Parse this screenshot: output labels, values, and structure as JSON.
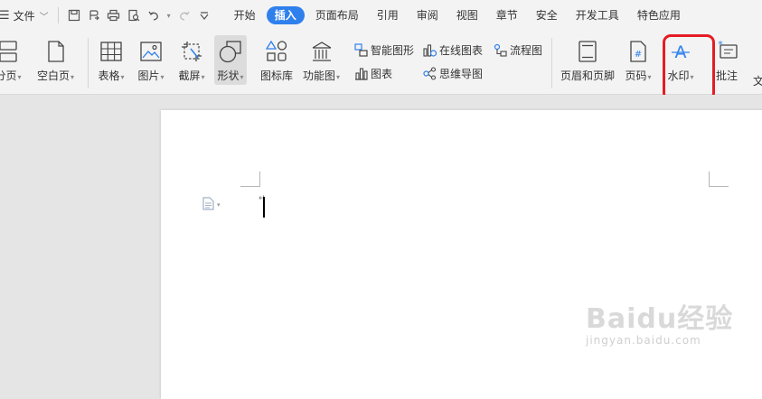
{
  "menu": {
    "file_label": "文件",
    "tabs": [
      "开始",
      "插入",
      "页面布局",
      "引用",
      "审阅",
      "视图",
      "章节",
      "安全",
      "开发工具",
      "特色应用"
    ],
    "active_tab": "插入",
    "accent_color": "#2f80ed"
  },
  "ribbon": {
    "page_break": "分页",
    "blank_page": "空白页",
    "table": "表格",
    "picture": "图片",
    "screenshot": "截屏",
    "shape": "形状",
    "icon_library": "图标库",
    "function_chart": "功能图",
    "smart_art": "智能图形",
    "chart": "图表",
    "online_chart": "在线图表",
    "mind_map": "思维导图",
    "flowchart": "流程图",
    "header_footer": "页眉和页脚",
    "page_number": "页码",
    "watermark": "水印",
    "comment": "批注",
    "text_cut": "文"
  },
  "highlight_color": "#e51c23",
  "brand_watermark": {
    "line1": "Baidu经验",
    "line2": "jingyan.baidu.com"
  }
}
